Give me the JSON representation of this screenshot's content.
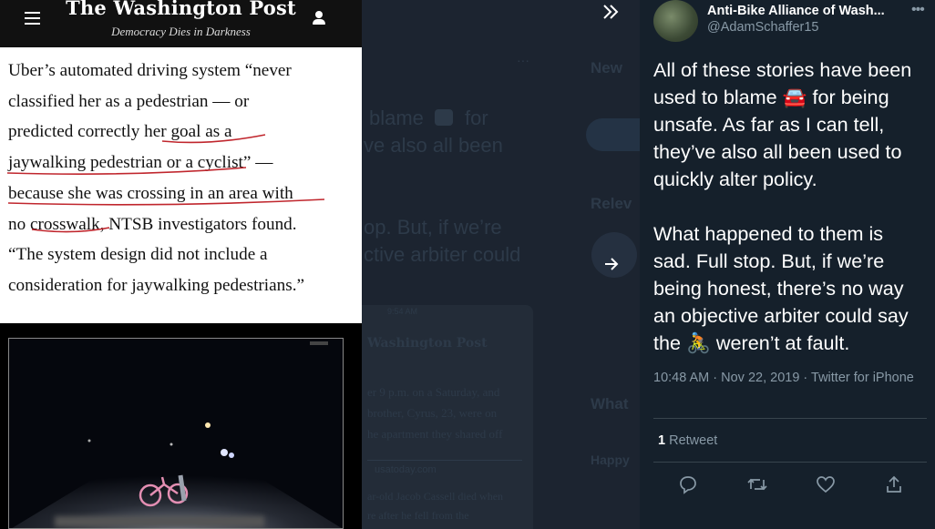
{
  "media": {
    "masthead": "The Washington Post",
    "tagline": "Democracy Dies in Darkness",
    "quote_lines": [
      "Uber’s automated driving system “never",
      "classified her as a pedestrian — or",
      "predicted correctly her goal as a",
      "jaywalking pedestrian or a cyclist” —",
      "because she was crossing in an area with",
      "no crosswalk, NTSB investigators found.",
      "“The system design did not include a",
      "consideration for jaywalking pedestrians.”"
    ],
    "video_label": "dashcam-video-still"
  },
  "backdrop": {
    "ghost_text_1": "blame",
    "ghost_text_2": "for",
    "ghost_text_3": "ve also all been",
    "ghost_text_4": "op. But, if we’re",
    "ghost_text_5": "ctive arbiter could",
    "ghost_new": "New",
    "ghost_rele": "Relev",
    "ghost_what": "What",
    "ghost_happy": "Happy",
    "phone_masthead": "Washington Post",
    "phone_time": "9:54 AM",
    "phone_lines": [
      "er 9 p.m. on a Saturday, and",
      "brother, Cyrus, 23, were on",
      "he apartment they shared off"
    ],
    "phone_url": "usatoday.com",
    "phone_lines_2": [
      "ar-old Jacob Cassell died when",
      "re after he fell from the"
    ]
  },
  "nav": {
    "collapse_icon": "double-chevron-right-icon",
    "next_icon": "arrow-right-icon"
  },
  "tweet": {
    "author_name": "Anti-Bike Alliance of Wash...",
    "author_handle": "@AdamSchaffer15",
    "body_part1": "All of these stories have been\nused to blame ",
    "car_emoji": "🚘",
    "body_part2": " for being\nunsafe. As far as I can tell,\nthey’ve also all been used to\nquickly alter policy.\n\nWhat happened to them is\nsad. Full stop. But, if we’re\nbeing honest, there’s no way\nan objective arbiter could say\nthe ",
    "bike_emoji": "🚴",
    "body_part3": " weren’t at fault.",
    "timestamp": "10:48 AM · Nov 22, 2019 · Twitter for iPhone",
    "retweet_count": "1",
    "retweet_label": "Retweet"
  },
  "colors": {
    "background": "#15202b",
    "secondary_text": "#8899a6",
    "underline": "#c0262d"
  }
}
